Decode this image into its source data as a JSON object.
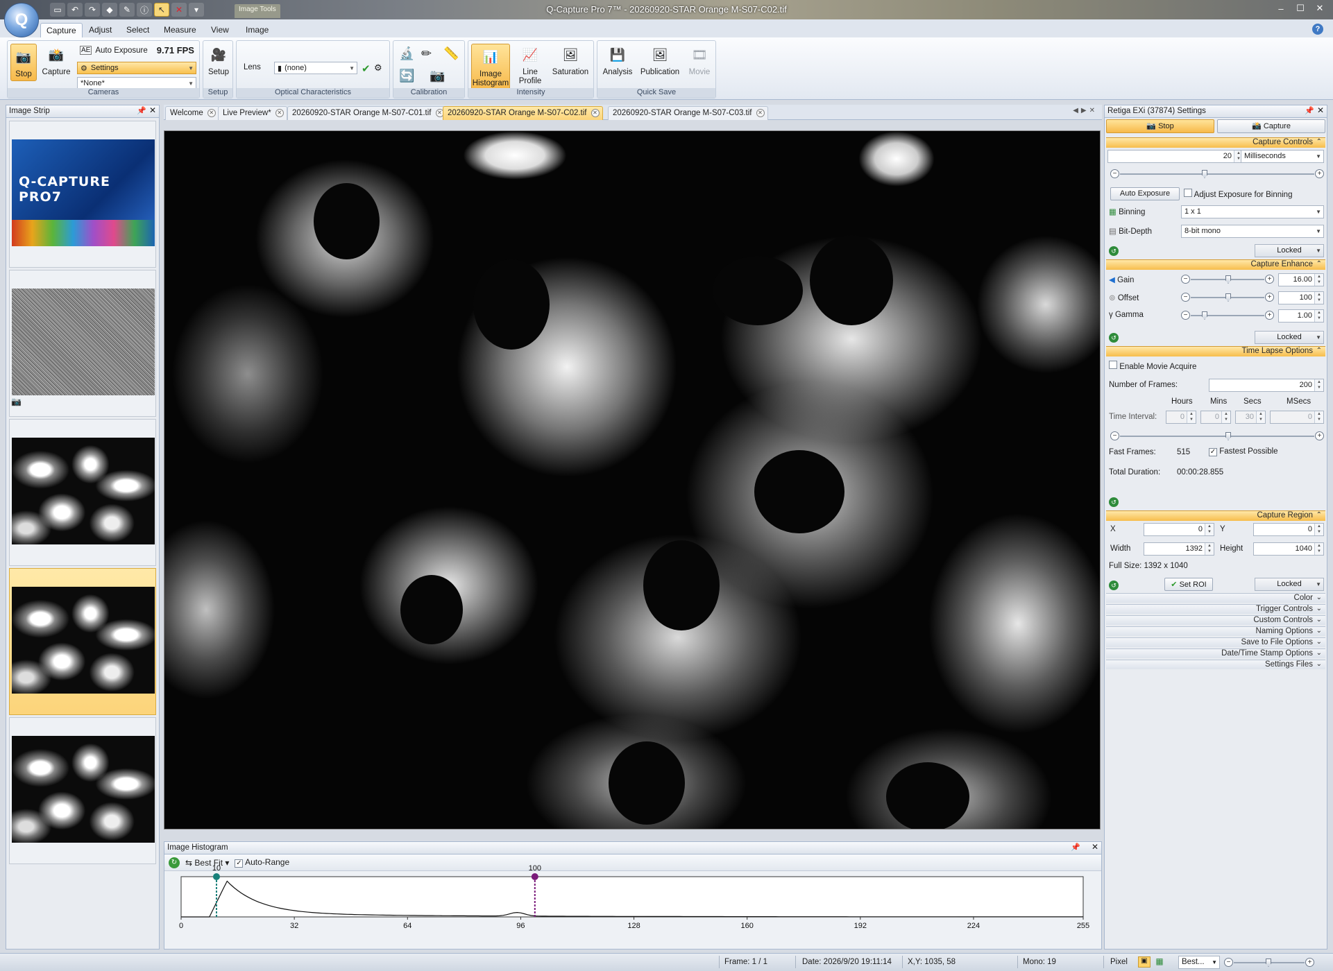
{
  "window": {
    "title": "Q-Capture Pro 7™ - 20260920-STAR Orange M-S07-C02.tif",
    "contextual_tab": "Image Tools",
    "controls": [
      "–",
      "☐",
      "✕"
    ]
  },
  "ribbon": {
    "tabs": [
      "Capture",
      "Adjust",
      "Select",
      "Measure",
      "View",
      "Image"
    ],
    "active_tab": "Capture",
    "groups": {
      "cameras": {
        "label": "Cameras",
        "stop_label": "Stop",
        "capture_label": "Capture",
        "auto_exposure_label": "Auto Exposure",
        "fps": "9.71 FPS",
        "settings_combo": "Settings",
        "preset_combo": "*None*"
      },
      "setup": {
        "label": "Setup",
        "setup_label": "Setup"
      },
      "optical": {
        "label": "Optical Characteristics",
        "lens_label": "Lens",
        "lens_value": "(none)"
      },
      "calibration": {
        "label": "Calibration"
      },
      "intensity": {
        "label": "Intensity",
        "histogram_label_1": "Image",
        "histogram_label_2": "Histogram",
        "line_profile_1": "Line",
        "line_profile_2": "Profile",
        "saturation_label": "Saturation"
      },
      "quicksave": {
        "label": "Quick Save",
        "analysis_label": "Analysis",
        "publication_label": "Publication",
        "movie_label": "Movie"
      }
    }
  },
  "image_strip": {
    "title": "Image Strip",
    "thumb1_logo": "Q-CAPTURE PRO7"
  },
  "doc_tabs": [
    {
      "label": "Welcome"
    },
    {
      "label": "Live Preview*"
    },
    {
      "label": "20260920-STAR Orange M-S07-C01.tif"
    },
    {
      "label": "20260920-STAR Orange M-S07-C02.tif"
    },
    {
      "label": "20260920-STAR Orange M-S07-C03.tif"
    }
  ],
  "histogram": {
    "title": "Image Histogram",
    "best_fit_label": "Best Fit",
    "auto_range_label": "Auto-Range",
    "auto_range_checked": true,
    "low_marker": "10",
    "high_marker": "100",
    "ticks": [
      "0",
      "32",
      "64",
      "96",
      "128",
      "160",
      "192",
      "224",
      "255"
    ],
    "colors": {
      "low": "#17807a",
      "high": "#7a1a7a"
    }
  },
  "settings": {
    "title": "Retiga EXi (37874) Settings",
    "stop_tab": "Stop",
    "capture_tab": "Capture",
    "capture_controls": {
      "header": "Capture Controls",
      "exposure_value": "20",
      "exposure_unit": "Milliseconds",
      "auto_exposure_btn": "Auto Exposure",
      "adjust_binning_label": "Adjust Exposure for Binning",
      "binning_label": "Binning",
      "binning_value": "1 x 1",
      "bitdepth_label": "Bit-Depth",
      "bitdepth_value": "8-bit mono",
      "locked": "Locked"
    },
    "capture_enhance": {
      "header": "Capture Enhance",
      "gain_label": "Gain",
      "gain_value": "16.00",
      "offset_label": "Offset",
      "offset_value": "100",
      "gamma_label": "Gamma",
      "gamma_value": "1.00",
      "locked": "Locked"
    },
    "time_lapse": {
      "header": "Time Lapse Options",
      "enable_movie_label": "Enable Movie Acquire",
      "frames_label": "Number of Frames:",
      "frames_value": "200",
      "hours_label": "Hours",
      "mins_label": "Mins",
      "secs_label": "Secs",
      "msecs_label": "MSecs",
      "interval_label": "Time Interval:",
      "hours_value": "0",
      "mins_value": "0",
      "secs_value": "30",
      "msecs_value": "0",
      "fast_frames_label": "Fast Frames:",
      "fast_frames_value": "515",
      "fastest_label": "Fastest Possible",
      "duration_label": "Total Duration:",
      "duration_value": "00:00:28.855"
    },
    "capture_region": {
      "header": "Capture Region",
      "x_label": "X",
      "x_value": "0",
      "y_label": "Y",
      "y_value": "0",
      "width_label": "Width",
      "width_value": "1392",
      "height_label": "Height",
      "height_value": "1040",
      "full_size": "Full Size: 1392 x 1040",
      "set_roi": "Set ROI",
      "locked": "Locked"
    },
    "collapsed_sections": [
      "Color",
      "Trigger Controls",
      "Custom Controls",
      "Naming Options",
      "Save to File Options",
      "Date/Time Stamp Options",
      "Settings Files"
    ]
  },
  "statusbar": {
    "frame": "Frame: 1 / 1",
    "date": "Date: 2026/9/20 19:11:14",
    "xy": "X,Y: 1035,   58",
    "mono": "Mono:    19",
    "unit": "Pixel",
    "zoom": "Best..."
  }
}
